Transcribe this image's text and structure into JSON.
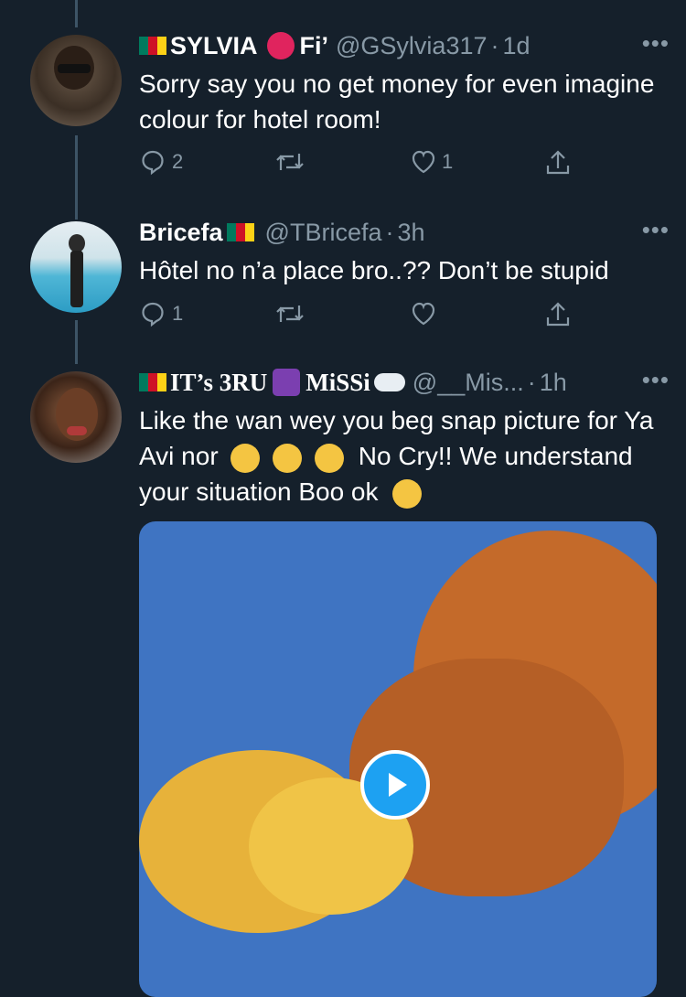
{
  "tweets": [
    {
      "name": "SYLVIA",
      "name_suffix": "Fi’",
      "handle": "@GSylvia317",
      "time": "1d",
      "text": "Sorry say you no get money for even imagine colour for hotel room!",
      "replies": "2",
      "retweets": "",
      "likes": "1"
    },
    {
      "name": "Bricefa",
      "handle": "@TBricefa",
      "time": "3h",
      "text": "Hôtel no n’a place bro..?? Don’t be stupid",
      "replies": "1",
      "retweets": "",
      "likes": ""
    },
    {
      "name": "IT’s 3RU",
      "name_mid": "MiSSi",
      "handle": "@__Mis...",
      "time": "1h",
      "text_part1": "Like the wan wey you beg snap picture for Ya Avi nor",
      "text_part2": "No Cry!! We understand your situation Boo ok"
    }
  ],
  "icons": {
    "more": "more-horizontal-icon",
    "reply": "reply-bubble-icon",
    "retweet": "retweet-icon",
    "like": "heart-icon",
    "share": "share-icon",
    "play": "play-icon"
  },
  "colors": {
    "background": "#15202b",
    "secondary_text": "#8899a6",
    "accent": "#1da1f2",
    "thread_line": "#3d5466"
  }
}
